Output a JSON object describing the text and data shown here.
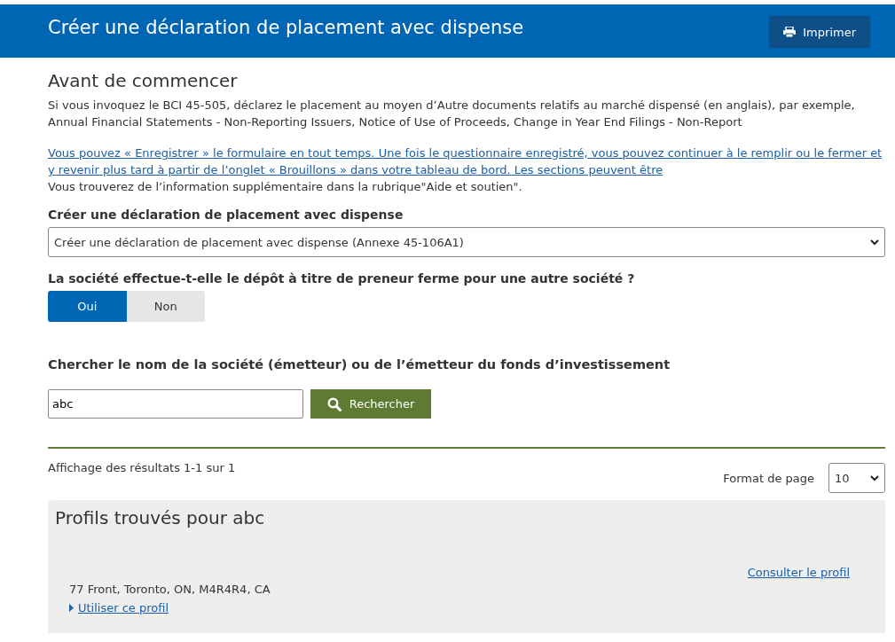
{
  "header": {
    "title": "Créer une déclaration de placement avec dispense",
    "print_button": "Imprimer"
  },
  "intro": {
    "heading": "Avant de commencer",
    "text": "Si vous invoquez le BCI 45-505, déclarez le placement au moyen d’Autre documents relatifs au marché dispensé (en anglais), par exemple, Annual Financial Statements - Non-Reporting Issuers, Notice of Use of Proceeds, Change in Year End Filings - Non-Report",
    "link": "Vous pouvez « Enregistrer » le formulaire en tout temps. Une fois le questionnaire enregistré, vous pouvez continuer à le remplir ou le fermer et y revenir plus tard à partir de l’onglet « Brouillons » dans votre tableau de bord. Les sections peuvent être",
    "note": "Vous trouverez de l’information supplémentaire dans la rubrique\"Aide et soutien\"."
  },
  "form_type": {
    "label": "Créer une déclaration de placement avec dispense",
    "value": "Créer une déclaration de placement avec dispense (Annexe 45-106A1)"
  },
  "underwriter": {
    "question": "La société effectue-t-elle le dépôt à titre de preneur ferme pour une autre société ?",
    "options": [
      {
        "label": "Oui",
        "selected": true
      },
      {
        "label": "Non",
        "selected": false
      }
    ]
  },
  "search": {
    "label": "Chercher le nom de la société (émetteur) ou de l’émetteur du fonds d’investissement",
    "value": "abc",
    "button": "Rechercher"
  },
  "results": {
    "summary": "Affichage des résultats 1-1 sur 1",
    "page_size_label": "Format de page",
    "page_size": "10",
    "title": "Profils trouvés pour abc",
    "profiles": [
      {
        "view_link": "Consulter le profil",
        "address": "77 Front, Toronto, ON, M4R4R4, CA",
        "use_link": "Utiliser ce profil"
      }
    ]
  }
}
